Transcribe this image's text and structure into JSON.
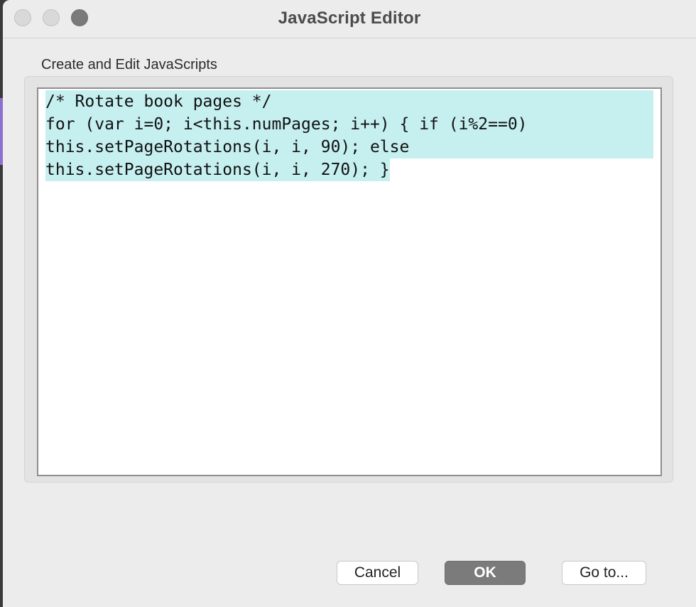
{
  "window": {
    "title": "JavaScript Editor"
  },
  "section": {
    "label": "Create and Edit JavaScripts"
  },
  "editor": {
    "lines": [
      "/* Rotate book pages */",
      "for (var i=0; i<this.numPages; i++) { if (i%2==0)",
      "this.setPageRotations(i, i, 90); else",
      "this.setPageRotations(i, i, 270); }"
    ],
    "selection_color": "#c6eff0"
  },
  "buttons": {
    "cancel": "Cancel",
    "ok": "OK",
    "goto": "Go to..."
  }
}
